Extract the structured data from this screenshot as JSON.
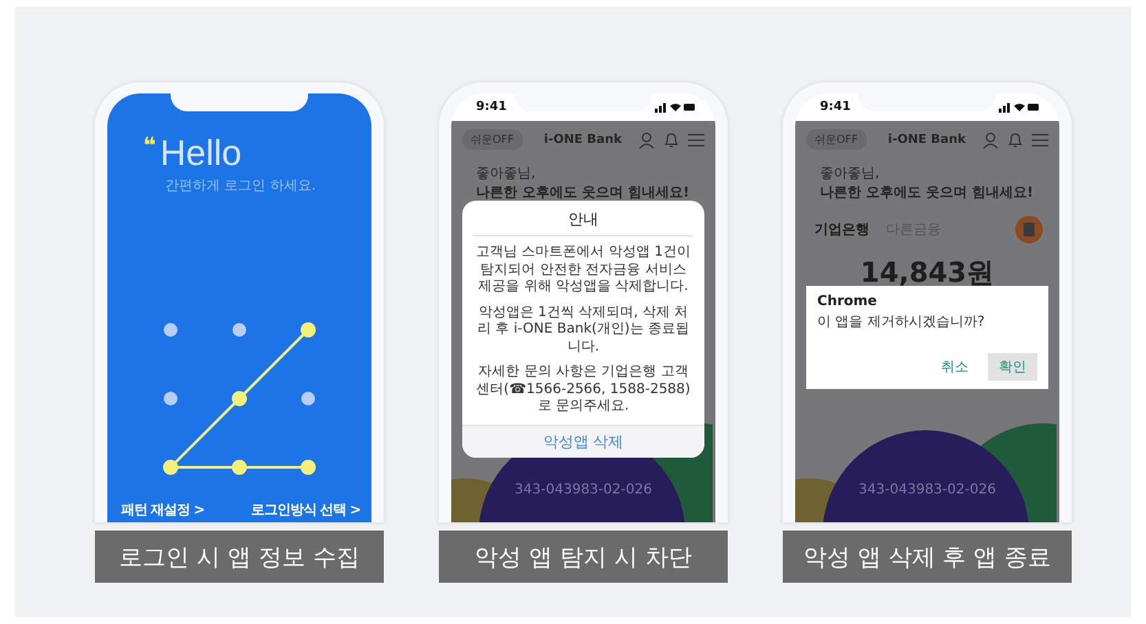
{
  "panels": [
    {
      "kind": "pattern_login",
      "caption": "로그인 시 앱 정보 수집",
      "screen": {
        "quote_mark": "❝",
        "title": "Hello",
        "subtitle": "간편하게 로그인 하세요.",
        "pattern": [
          {
            "selected": false
          },
          {
            "selected": false
          },
          {
            "selected": true
          },
          {
            "selected": false
          },
          {
            "selected": true
          },
          {
            "selected": false
          },
          {
            "selected": true
          },
          {
            "selected": true
          },
          {
            "selected": true
          }
        ],
        "links": [
          "패턴 재설정 >",
          "로그인방식 선택 >"
        ]
      }
    },
    {
      "kind": "alert",
      "caption": "악성 앱 탐지 시 차단",
      "screen": {
        "status_time": "9:41",
        "easy_mode": "쉬운OFF",
        "brand": "i-ONE Bank",
        "greeting": [
          "좋아좋님,",
          "나른한 오후에도 웃으며 힘내세요!"
        ],
        "account": "343-043983-02-026",
        "dialog": {
          "title": "안내",
          "paragraphs": [
            "고객님 스마트폰에서 악성앱 1건이 탐지되어 안전한 전자금융 서비스 제공을 위해 악성앱을 삭제합니다.",
            "악성앱은 1건씩 삭제되며, 삭제 처리 후 i-ONE Bank(개인)는 종료됩니다.",
            "자세한 문의 사항은 기업은행 고객센터(☎1566-2566, 1588-2588)로 문의주세요."
          ],
          "button": "악성앱 삭제"
        }
      }
    },
    {
      "kind": "confirm",
      "caption": "악성 앱 삭제 후 앱 종료",
      "screen": {
        "status_time": "9:41",
        "easy_mode": "쉬운OFF",
        "brand": "i-ONE Bank",
        "greeting": [
          "좋아좋님,",
          "나른한 오후에도 웃으며 힘내세요!"
        ],
        "tabs": [
          {
            "label": "기업은행",
            "selected": true
          },
          {
            "label": "다른금융",
            "selected": false
          }
        ],
        "balance": "14,843원",
        "account": "343-043983-02-026",
        "dialog": {
          "title": "Chrome",
          "message": "이 앱을 제거하시겠습니까?",
          "buttons": [
            "취소",
            "확인"
          ]
        }
      }
    }
  ]
}
